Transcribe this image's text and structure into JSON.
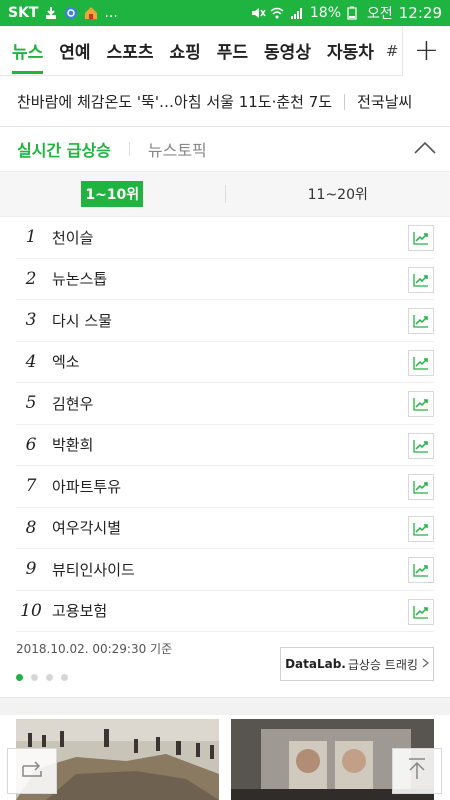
{
  "statusbar": {
    "carrier": "SKT",
    "more": "...",
    "battery": "18%",
    "ampm": "오전",
    "time": "12:29"
  },
  "tabs": {
    "items": [
      {
        "label": "뉴스"
      },
      {
        "label": "연예"
      },
      {
        "label": "스포츠"
      },
      {
        "label": "쇼핑"
      },
      {
        "label": "푸드"
      },
      {
        "label": "동영상"
      },
      {
        "label": "자동차"
      }
    ],
    "hash": "#",
    "plus": "+"
  },
  "weather": {
    "headline": "찬바람에 체감온도 '뚝'…아침 서울 11도·춘천 7도",
    "link": "전국날씨"
  },
  "realtime": {
    "title": "실시간 급상승",
    "alt_tab": "뉴스토픽",
    "range_selected": "1~10위",
    "range_other": "11~20위",
    "items": [
      {
        "rank": "1",
        "keyword": "천이슬"
      },
      {
        "rank": "2",
        "keyword": "뉴논스톱"
      },
      {
        "rank": "3",
        "keyword": "다시 스물"
      },
      {
        "rank": "4",
        "keyword": "엑소"
      },
      {
        "rank": "5",
        "keyword": "김현우"
      },
      {
        "rank": "6",
        "keyword": "박환희"
      },
      {
        "rank": "7",
        "keyword": "아파트투유"
      },
      {
        "rank": "8",
        "keyword": "여우각시별"
      },
      {
        "rank": "9",
        "keyword": "뷰티인사이드"
      },
      {
        "rank": "10",
        "keyword": "고용보험"
      }
    ],
    "timestamp": "2018.10.02. 00:29:30 기준",
    "datalab_name": "DataLab.",
    "datalab_sub": "급상승 트래킹"
  },
  "colors": {
    "accent": "#1fb340"
  }
}
